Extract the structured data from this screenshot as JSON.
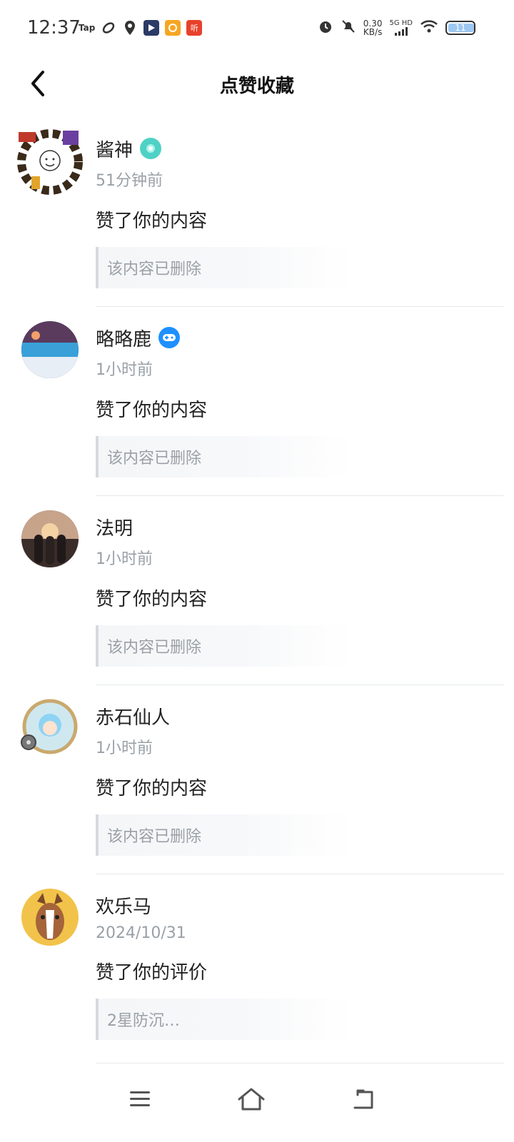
{
  "status": {
    "time": "12:37",
    "tap": "Tap",
    "ting": "听",
    "speed_value": "0.30",
    "speed_unit": "KB/s",
    "network": "5G HD",
    "battery": "11"
  },
  "header": {
    "title": "点赞收藏"
  },
  "items": [
    {
      "name": "酱神",
      "time": "51分钟前",
      "action": "赞了你的内容",
      "quote": "该内容已删除",
      "badge": "teal-badge-icon",
      "badge_color": "#4fd1c5"
    },
    {
      "name": "略略鹿",
      "time": "1小时前",
      "action": "赞了你的内容",
      "quote": "该内容已删除",
      "badge": "gamepad-badge-icon",
      "badge_color": "#1e90ff"
    },
    {
      "name": "法明",
      "time": "1小时前",
      "action": "赞了你的内容",
      "quote": "该内容已删除"
    },
    {
      "name": "赤石仙人",
      "time": "1小时前",
      "action": "赞了你的内容",
      "quote": "该内容已删除"
    },
    {
      "name": "欢乐马",
      "time": "2024/10/31",
      "action": "赞了你的评价",
      "quote": "2星防沉…"
    }
  ]
}
